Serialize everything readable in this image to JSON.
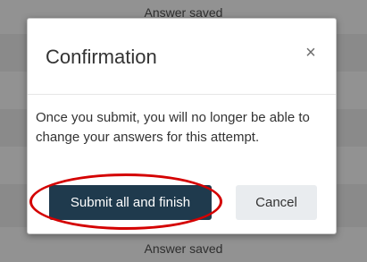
{
  "background": {
    "rows": [
      "Answer saved",
      "",
      "",
      "",
      "",
      "",
      "Answer saved"
    ]
  },
  "dialog": {
    "title": "Confirmation",
    "close_icon": "close-icon",
    "close_glyph": "×",
    "message": "Once you submit, you will no longer be able to change your answers for this attempt.",
    "submit_label": "Submit all and finish",
    "cancel_label": "Cancel"
  },
  "colors": {
    "primary_button": "#1f3a4d",
    "secondary_button": "#e9ecef",
    "highlight": "#d40000",
    "overlay": "#8a8a8a"
  }
}
